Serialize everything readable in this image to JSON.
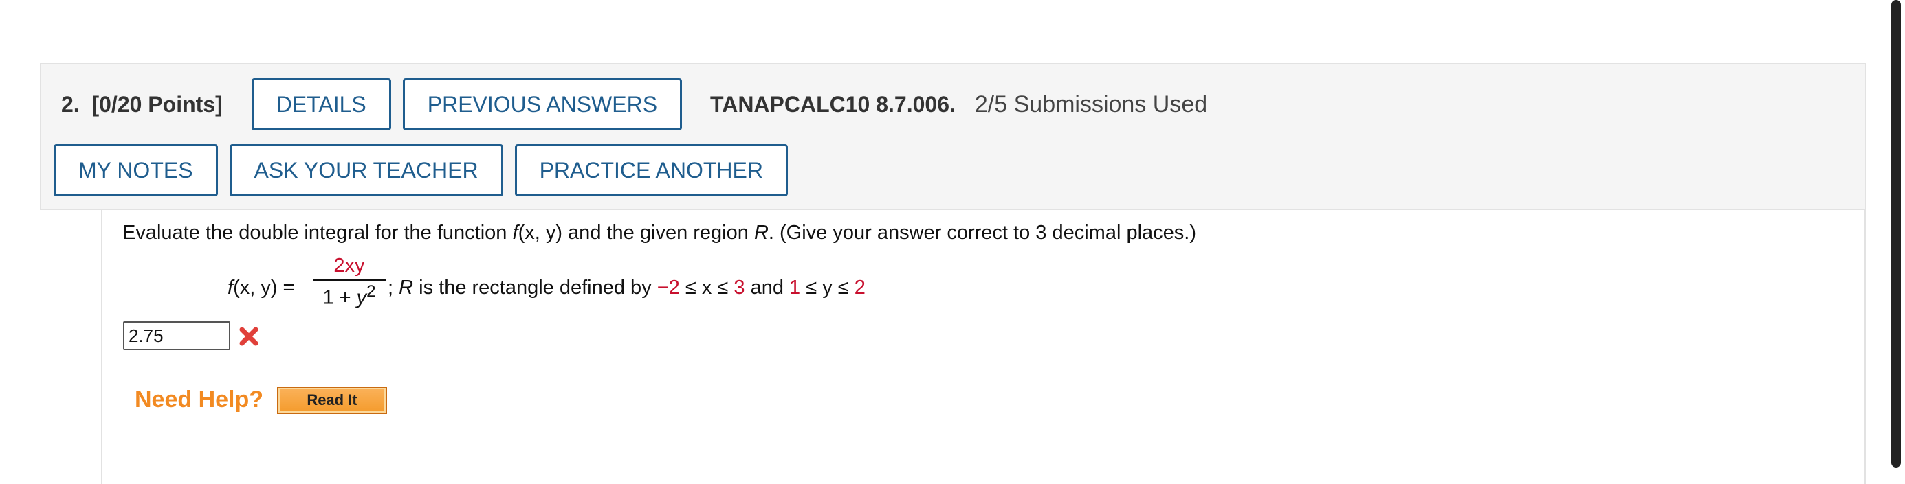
{
  "question": {
    "number_label": "2.",
    "points_label": "[0/20 Points]",
    "details_label": "DETAILS",
    "previous_answers_label": "PREVIOUS ANSWERS",
    "code": "TANAPCALC10 8.7.006.",
    "submissions": "2/5 Submissions Used",
    "my_notes_label": "MY NOTES",
    "ask_teacher_label": "ASK YOUR TEACHER",
    "practice_another_label": "PRACTICE ANOTHER"
  },
  "prompt": {
    "part1": "Evaluate the double integral for the function ",
    "fx": "f",
    "xy": "(x, y)",
    "part2": " and the given region ",
    "R": "R",
    "part3": ". (Give your answer correct to 3 decimal places.)"
  },
  "function": {
    "lhs_f": "f",
    "lhs_args": "(x, y) =",
    "numerator": "2xy",
    "denominator_a": "1 + ",
    "denominator_y": "y",
    "denominator_exp": "2",
    "sep": "; ",
    "R": "R",
    "region_text": " is the rectangle defined by ",
    "x_low": "−2",
    "x_mid": " ≤ x ≤ ",
    "x_high": "3",
    "and": " and ",
    "y_low": "1",
    "y_mid": " ≤ y ≤ ",
    "y_high": "2"
  },
  "answer": {
    "value": "2.75",
    "status": "incorrect",
    "status_icon": "x-icon"
  },
  "help": {
    "need_help": "Need Help?",
    "read_it": "Read It"
  },
  "colors": {
    "accent": "#1f5d8e",
    "highlight_red": "#c8102e",
    "help_orange": "#f28a22"
  }
}
